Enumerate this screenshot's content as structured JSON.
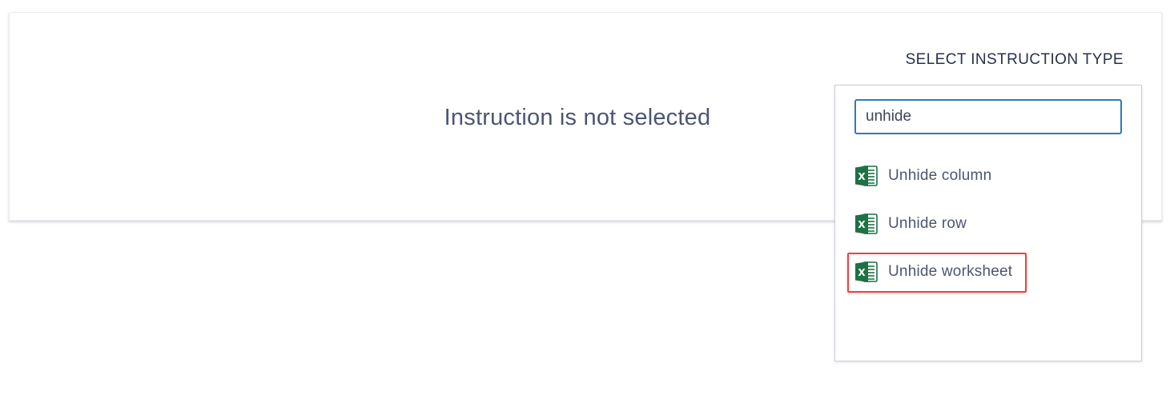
{
  "main": {
    "empty_message": "Instruction is not selected"
  },
  "instruction_picker": {
    "heading": "SELECT INSTRUCTION TYPE",
    "search": {
      "value": "unhide"
    },
    "options": [
      {
        "label": "Unhide column",
        "icon": "excel-icon"
      },
      {
        "label": "Unhide row",
        "icon": "excel-icon"
      },
      {
        "label": "Unhide worksheet",
        "icon": "excel-icon",
        "highlighted": true
      }
    ]
  },
  "colors": {
    "excel_green": "#1e7145",
    "search_border": "#2f7ab8",
    "highlight_red": "#e0474c",
    "text": "#4b5671"
  }
}
